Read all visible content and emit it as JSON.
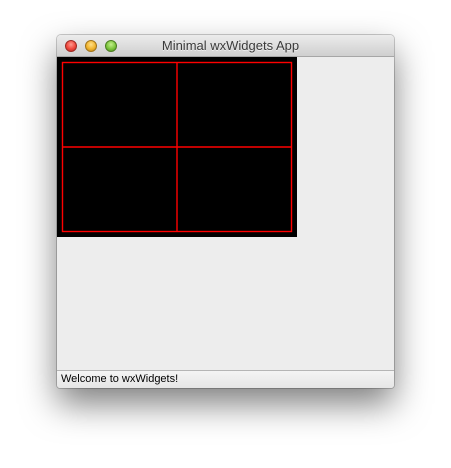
{
  "window": {
    "title": "Minimal wxWidgets App"
  },
  "canvas": {
    "background_color": "#000000",
    "line_color": "#ff0000"
  },
  "statusbar": {
    "text": "Welcome to wxWidgets!"
  }
}
